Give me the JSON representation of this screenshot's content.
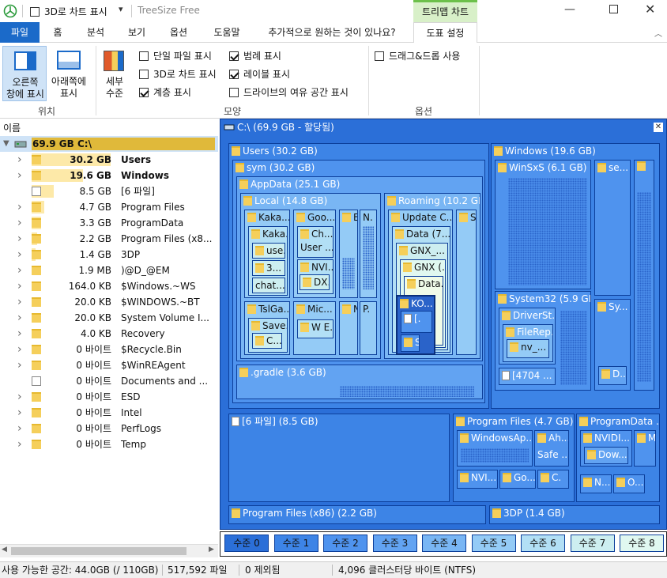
{
  "titlebar": {
    "qat_label": "3D로 차트 표시",
    "app_name": "TreeSize Free",
    "context_tab": "트리맵 차트"
  },
  "tabs": [
    "파일",
    "홈",
    "분석",
    "보기",
    "옵션",
    "도움말",
    "추가적으로 원하는 것이 있나요?",
    "도표 설정"
  ],
  "ribbon": {
    "pos_right": "오른쪽\n창에 표시",
    "pos_bottom": "아래쪽에\n표시",
    "group_position": "위치",
    "detail": "세부\n수준",
    "options": [
      {
        "label": "단일 파일 표시",
        "checked": false
      },
      {
        "label": "3D로 차트 표시",
        "checked": false
      },
      {
        "label": "계층 표시",
        "checked": true
      },
      {
        "label": "범례 표시",
        "checked": true
      },
      {
        "label": "레이블 표시",
        "checked": true
      },
      {
        "label": "드라이브의 여유 공간 표시",
        "checked": false
      }
    ],
    "group_shape": "모양",
    "dragdrop": "드래그&드롭 사용",
    "group_options": "옵션"
  },
  "tree": {
    "header": "이름",
    "root": {
      "size": "69.9 GB",
      "name": "C:\\"
    },
    "rows": [
      {
        "size": "30.2 GB",
        "name": "Users",
        "bold": true,
        "pct": 43,
        "type": "folder"
      },
      {
        "size": "19.6 GB",
        "name": "Windows",
        "bold": true,
        "pct": 28,
        "type": "folder"
      },
      {
        "size": "8.5 GB",
        "name": "[6 파일]",
        "pct": 12,
        "type": "file"
      },
      {
        "size": "4.7 GB",
        "name": "Program Files",
        "pct": 7,
        "type": "folder"
      },
      {
        "size": "3.3 GB",
        "name": "ProgramData",
        "pct": 5,
        "type": "folder"
      },
      {
        "size": "2.2 GB",
        "name": "Program Files (x8...",
        "pct": 3,
        "type": "folder"
      },
      {
        "size": "1.4 GB",
        "name": "3DP",
        "pct": 2,
        "type": "folder"
      },
      {
        "size": "1.9 MB",
        "name": ")@D_@EM",
        "pct": 0,
        "type": "folder"
      },
      {
        "size": "164.0 KB",
        "name": "$Windows.~WS",
        "pct": 0,
        "type": "folder"
      },
      {
        "size": "20.0 KB",
        "name": "$WINDOWS.~BT",
        "pct": 0,
        "type": "folder"
      },
      {
        "size": "20.0 KB",
        "name": "System Volume I...",
        "pct": 0,
        "type": "folder"
      },
      {
        "size": "4.0 KB",
        "name": "Recovery",
        "pct": 0,
        "type": "folder"
      },
      {
        "size": "0 바이트",
        "name": "$Recycle.Bin",
        "pct": 0,
        "type": "folder"
      },
      {
        "size": "0 바이트",
        "name": "$WinREAgent",
        "pct": 0,
        "type": "folder"
      },
      {
        "size": "0 바이트",
        "name": "Documents and ...",
        "pct": 0,
        "type": "link"
      },
      {
        "size": "0 바이트",
        "name": "ESD",
        "pct": 0,
        "type": "folder"
      },
      {
        "size": "0 바이트",
        "name": "Intel",
        "pct": 0,
        "type": "folder"
      },
      {
        "size": "0 바이트",
        "name": "PerfLogs",
        "pct": 0,
        "type": "folder"
      },
      {
        "size": "0 바이트",
        "name": "Temp",
        "pct": 0,
        "type": "folder"
      }
    ]
  },
  "treemap": {
    "title": "C:\\ (69.9 GB - 할당됨)",
    "labels": {
      "users": "Users (30.2 GB)",
      "sym": "sym (30.2 GB)",
      "appdata": "AppData (25.1 GB)",
      "local": "Local (14.8 GB)",
      "roaming": "Roaming (10.2 GB)",
      "gradle": ".gradle (3.6 GB)",
      "windows": "Windows (19.6 GB)",
      "winsxs": "WinSxS (6.1 GB)",
      "system32": "System32 (5.9 GB)",
      "driverst": "DriverSt...",
      "filerep": "FileRep...",
      "nv": "nv_...",
      "f4704": "[4704 ...",
      "files6": "[6 파일] (8.5 GB)",
      "pf": "Program Files (4.7 GB)",
      "pd": "ProgramData ...",
      "pf86": "Program Files (x86) (2.2 GB)",
      "dp3": "3DP (1.4 GB)",
      "kaka1": "Kaka...",
      "kaka2": "Kaka...",
      "use": "use...",
      "n3": "3...",
      "chat": "chat...",
      "goo": "Goo...",
      "ch": "Ch...",
      "user": "User ...",
      "nvi": "NVI...",
      "dx": "DX...",
      "tslga": "TslGa...",
      "save": "Save...",
      "c1": "C...",
      "mic": "Mic...",
      "wue": "W E...",
      "update": "Update C...",
      "data7": "Data (7....",
      "gnx1": "GNX_...",
      "gnx2": "GNX (...",
      "data": "Data...",
      "ko": "KO...",
      "windowsap": "WindowsAp...",
      "ah": "Ah...",
      "safe": "Safe ...",
      "nvi2": "NVI...",
      "go2": "Go...",
      "nvidi": "NVIDI...",
      "dow": "Dow...",
      "n2": "N...",
      "o2": "O...",
      "se": "se...",
      "sy": "Sy...",
      "l3": "[3...",
      "j": "J.",
      "s": "S.",
      "d": "D...",
      "p": "P..."
    },
    "levels": [
      "수준 0",
      "수준 1",
      "수준 2",
      "수준 3",
      "수준 4",
      "수준 5",
      "수준 6",
      "수준 7",
      "수준 8"
    ]
  },
  "status": {
    "free": "사용 가능한 공간: 44.0GB  (/ 110GB)",
    "files": "517,592 파일",
    "excluded": "0 제외됨",
    "cluster": "4,096 클러스터당 바이트 (NTFS)"
  }
}
